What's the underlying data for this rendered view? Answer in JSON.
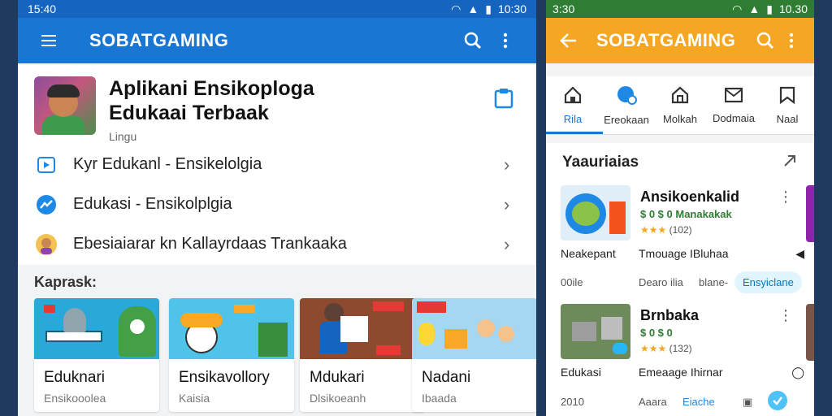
{
  "left": {
    "status": {
      "time": "15:40",
      "right_time": "10:30"
    },
    "appbar": {
      "title": "SOBATGAMING"
    },
    "hero": {
      "title_line1": "Aplikani Ensikoploga",
      "title_line2": "Edukaai Terbaak",
      "subtitle": "Lingu"
    },
    "menu": [
      {
        "label": "Kyr Edukanl - Ensikelolgia"
      },
      {
        "label": "Edukasi - Ensikolplgia"
      },
      {
        "label": "Ebesiaiarar kn Kallayrdaas Trankaaka"
      }
    ],
    "section": "Kaprask:",
    "tiles": [
      {
        "title": "Eduknari",
        "sub": "Ensikooolea"
      },
      {
        "title": "Ensikavollory",
        "sub": "Kaisia"
      },
      {
        "title": "Mdukari",
        "sub": "Dlsikoeanh"
      },
      {
        "title": "Nadani",
        "sub": "Ibaada"
      }
    ]
  },
  "right": {
    "status": {
      "time": "3:30",
      "right_time": "10.30"
    },
    "appbar": {
      "title": "SOBATGAMING"
    },
    "tabs": [
      {
        "label": "Rila",
        "icon": "home-icon"
      },
      {
        "label": "Ereokaan",
        "icon": "chat-icon"
      },
      {
        "label": "Molkah",
        "icon": "house-icon"
      },
      {
        "label": "Dodmaia",
        "icon": "mail-icon"
      },
      {
        "label": "Naal",
        "icon": "bookmark-icon"
      }
    ],
    "section": "Yaauriaias",
    "cards": [
      {
        "name": "Ansikoenkalid",
        "meta": "$ 0 $ 0 Manakakak",
        "rating": "★★★",
        "rating_count": "(102)",
        "row2_a": "Neakepant",
        "row2_b": "Tmouage IBluhaa",
        "row3_a": "00ile",
        "row3_b": "Dearo ilia",
        "row3_c": "blane-",
        "pill": "Ensyiclane"
      },
      {
        "name": "Brnbaka",
        "meta": "$ 0 $ 0",
        "rating": "★★★",
        "rating_count": "(132)",
        "row2_a": "Edukasi",
        "row2_b": "Emeaage Ihirnar",
        "row3_a": "2010",
        "row3_b": "Aaara",
        "row3_c": "Eiache"
      }
    ]
  },
  "colors": {
    "left_appbar": "#1976d2",
    "right_appbar": "#f5a623",
    "accent_green": "#2e7d32"
  }
}
